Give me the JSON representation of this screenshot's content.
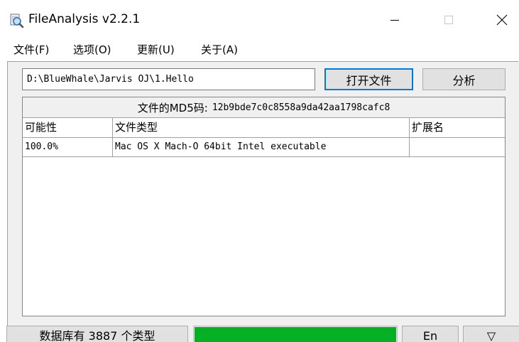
{
  "window": {
    "title": "FileAnalysis v2.2.1",
    "app_icon": "magnifier-document-icon",
    "controls": {
      "minimize_icon": "minimize-icon",
      "maximize_icon": "maximize-icon",
      "close_icon": "close-icon"
    }
  },
  "menu": {
    "items": [
      {
        "label": "文件(F)"
      },
      {
        "label": "选项(O)"
      },
      {
        "label": "更新(U)"
      },
      {
        "label": "关于(A)"
      }
    ]
  },
  "toolbar": {
    "path_value": "D:\\BlueWhale\\Jarvis OJ\\1.Hello",
    "open_label": "打开文件",
    "analyze_label": "分析"
  },
  "results": {
    "md5_label": "文件的MD5码:",
    "md5_value": "12b9bde7c0c8558a9da42aa1798cafc8",
    "columns": [
      "可能性",
      "文件类型",
      "扩展名"
    ],
    "rows": [
      {
        "probability": "100.0%",
        "type": "Mac OS X Mach-O 64bit Intel executable",
        "extension": ""
      }
    ]
  },
  "status": {
    "db_text": "数据库有 3887 个类型",
    "progress": 1.0,
    "lang_label": "En",
    "more_label": "▽"
  },
  "colors": {
    "accent": "#0078d7",
    "progress_fill": "#06b025",
    "button_face": "#e1e1e1",
    "panel_bg": "#f0f0f0"
  }
}
